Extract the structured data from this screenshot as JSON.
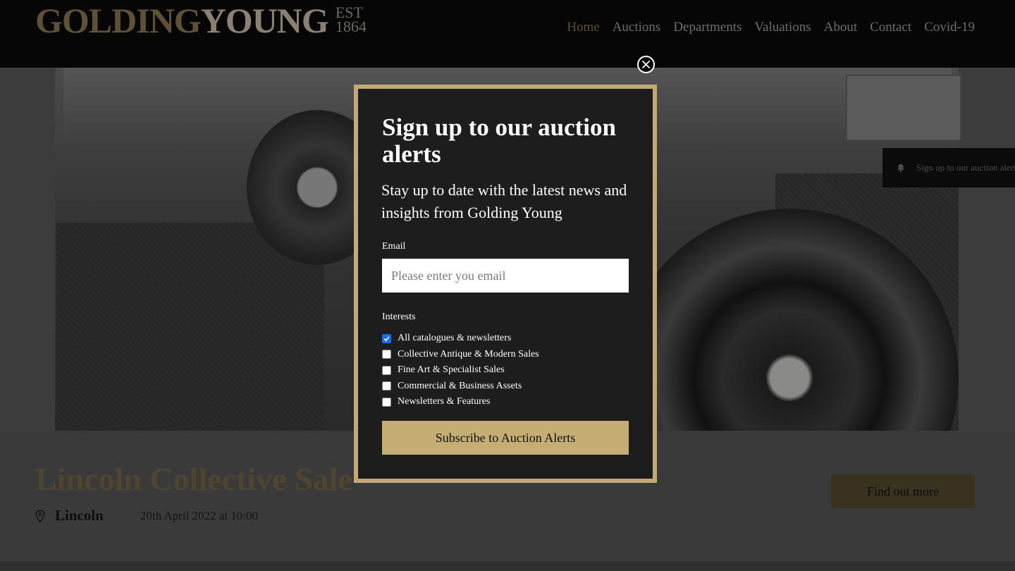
{
  "brand": {
    "name_part1": "GOLDING",
    "name_part2": "YOUNG",
    "est_line1": "EST",
    "est_line2": "1864",
    "gold": "#c2ab72"
  },
  "nav": {
    "items": [
      {
        "label": "Home",
        "active": true
      },
      {
        "label": "Auctions"
      },
      {
        "label": "Departments"
      },
      {
        "label": "Valuations"
      },
      {
        "label": "About"
      },
      {
        "label": "Contact"
      },
      {
        "label": "Covid-19"
      }
    ]
  },
  "side_tab": {
    "icon": "bell-icon",
    "label": "Sign up to our auction alerts"
  },
  "sale": {
    "title": "Lincoln Collective Sale",
    "location_icon": "map-pin-icon",
    "location": "Lincoln",
    "date": "20th April 2022 at 10:00",
    "cta": "Find out more"
  },
  "modal": {
    "close_icon": "close-icon",
    "title": "Sign up to our auction alerts",
    "subtitle": "Stay up to date with the latest news and insights from Golding Young",
    "email_label": "Email",
    "email_placeholder": "Please enter you email",
    "email_value": "",
    "interests_label": "Interests",
    "interests": [
      {
        "label": "All catalogues & newsletters",
        "checked": true
      },
      {
        "label": "Collective Antique & Modern Sales",
        "checked": false
      },
      {
        "label": "Fine Art & Specialist Sales",
        "checked": false
      },
      {
        "label": "Commercial & Business Assets",
        "checked": false
      },
      {
        "label": "Newsletters & Features",
        "checked": false
      }
    ],
    "submit_label": "Subscribe to Auction Alerts"
  }
}
